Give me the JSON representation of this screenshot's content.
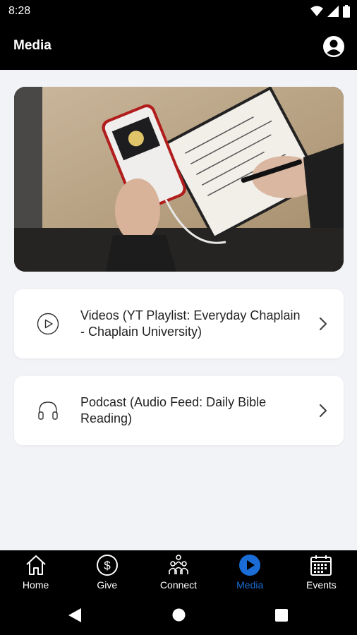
{
  "status_bar": {
    "time": "8:28"
  },
  "app_bar": {
    "title": "Media"
  },
  "media_items": [
    {
      "label": "Videos (YT Playlist: Everyday Chaplain - Chaplain University)",
      "icon": "play-circle-icon"
    },
    {
      "label": "Podcast (Audio Feed: Daily Bible Reading)",
      "icon": "headphones-icon"
    }
  ],
  "bottom_nav": [
    {
      "label": "Home",
      "icon": "home-icon"
    },
    {
      "label": "Give",
      "icon": "dollar-circle-icon"
    },
    {
      "label": "Connect",
      "icon": "people-icon"
    },
    {
      "label": "Media",
      "icon": "play-circle-filled-icon",
      "active": true
    },
    {
      "label": "Events",
      "icon": "calendar-icon"
    }
  ],
  "colors": {
    "accent": "#1a6dd6",
    "background": "#f2f3f7",
    "bar": "#000000"
  }
}
